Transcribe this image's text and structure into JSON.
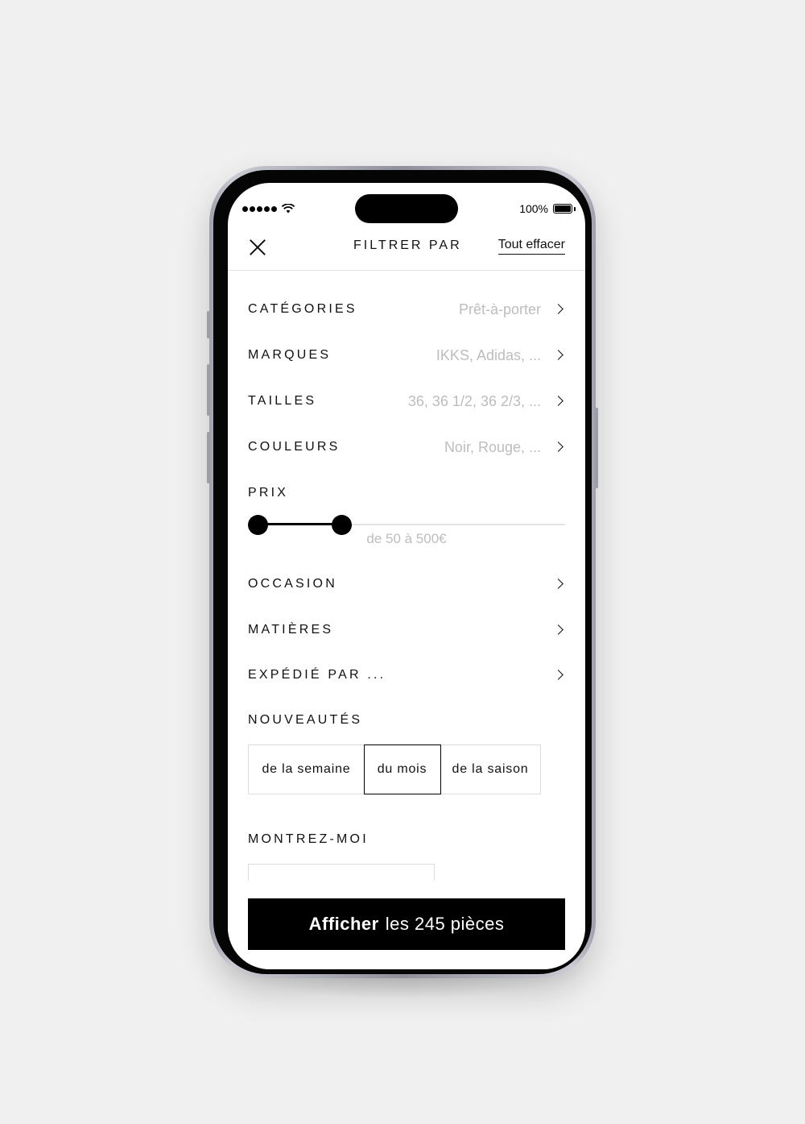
{
  "status_bar": {
    "battery_percent": "100%"
  },
  "header": {
    "title": "FILTRER PAR",
    "clear_all": "Tout effacer"
  },
  "filters": [
    {
      "label": "CATÉGORIES",
      "value": "Prêt-à-porter"
    },
    {
      "label": "MARQUES",
      "value": "IKKS, Adidas, ..."
    },
    {
      "label": "TAILLES",
      "value": "36, 36 1/2, 36 2/3, ..."
    },
    {
      "label": "COULEURS",
      "value": "Noir, Rouge, ..."
    }
  ],
  "price": {
    "label": "PRIX",
    "range_text": "de 50 à 500€",
    "min": 50,
    "max": 500
  },
  "more_filters": [
    {
      "label": "OCCASION"
    },
    {
      "label": "MATIÈRES"
    },
    {
      "label": "EXPÉDIÉ PAR ..."
    }
  ],
  "news": {
    "label": "NOUVEAUTÉS",
    "options": [
      "de la semaine",
      "du mois",
      "de la saison"
    ],
    "selected": "du mois"
  },
  "show_me": {
    "label": "MONTREZ-MOI"
  },
  "cta": {
    "bold": "Afficher",
    "rest": "les 245 pièces"
  }
}
